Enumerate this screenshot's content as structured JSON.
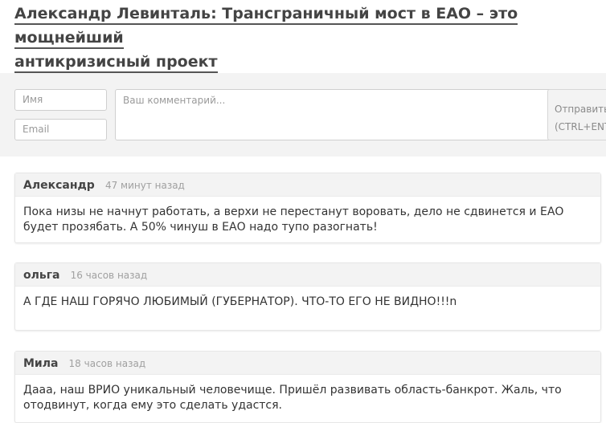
{
  "article": {
    "title_line1": "Александр Левинталь: Трансграничный мост в ЕАО – это мощнейший",
    "title_line2": "антикризисный проект"
  },
  "form": {
    "name_placeholder": "Имя",
    "email_placeholder": "Email",
    "comment_placeholder": "Ваш комментарий...",
    "send_label": "Отправить",
    "send_hint": "(CTRL+ENTER)"
  },
  "comments": [
    {
      "author": "Александр",
      "time": "47 минут назад",
      "text": "Пока низы не начнут работать, а верхи не перестанут воровать, дело не сдвинется и ЕАО будет прозябать. А 50% чинуш в ЕАО надо тупо разогнать!"
    },
    {
      "author": "ольга",
      "time": "16 часов назад",
      "text": "А ГДЕ НАШ ГОРЯЧО ЛЮБИМЫЙ (ГУБЕРНАТОР). ЧТО-ТО ЕГО НЕ ВИДНО!!!n"
    },
    {
      "author": "Мила",
      "time": "18 часов назад",
      "text": "Дааа, наш ВРИО уникальный человечище. Пришёл развивать область-банкрот. Жаль, что отодвинут, когда ему это сделать удастся."
    }
  ],
  "colors": {
    "band": "#f3f3f3",
    "title": "#444444",
    "muted": "#a0a0a0"
  }
}
